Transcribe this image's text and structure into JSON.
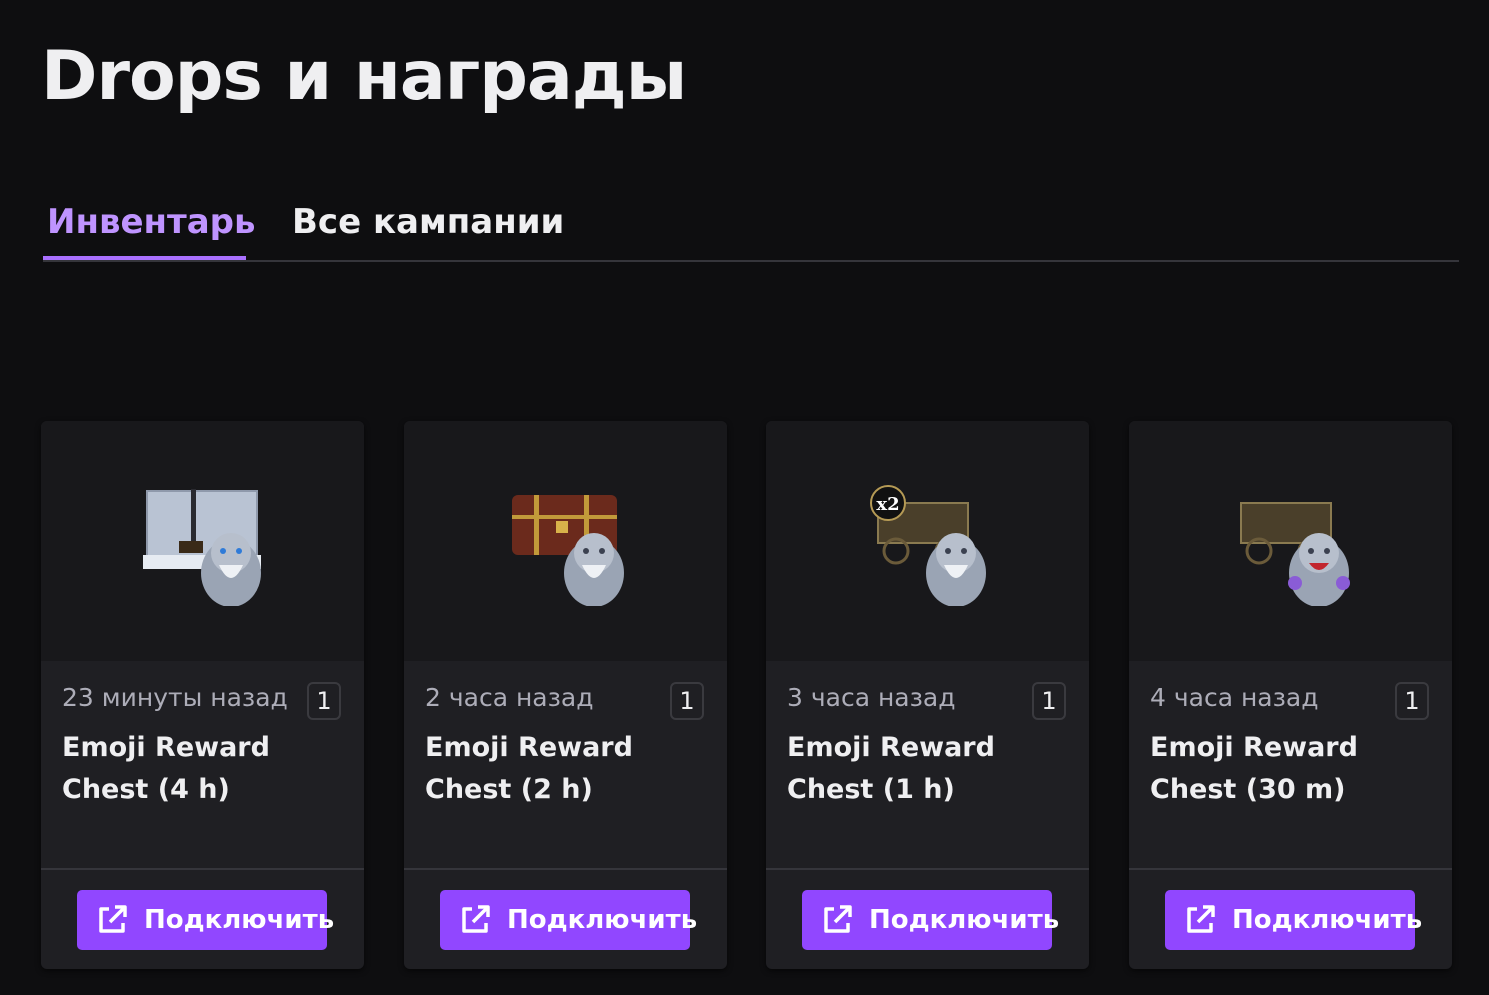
{
  "page": {
    "title": "Drops и награды"
  },
  "tabs": [
    {
      "label": "Инвентарь",
      "active": true
    },
    {
      "label": "Все кампании",
      "active": false
    }
  ],
  "cards": [
    {
      "time": "23 минуты назад",
      "quantity": "1",
      "name": "Emoji Reward Chest (4 h)",
      "button_label": "Подключить",
      "image_icon": "ice-chest-character-icon"
    },
    {
      "time": "2 часа назад",
      "quantity": "1",
      "name": "Emoji Reward Chest (2 h)",
      "button_label": "Подключить",
      "image_icon": "wooden-chest-character-icon"
    },
    {
      "time": "3 часа назад",
      "quantity": "1",
      "name": "Emoji Reward Chest (1 h)",
      "button_label": "Подключить",
      "image_icon": "cart-x2-character-icon",
      "image_badge": "x2"
    },
    {
      "time": "4 часа назад",
      "quantity": "1",
      "name": "Emoji Reward Chest (30 m)",
      "button_label": "Подключить",
      "image_icon": "cart-character-icon"
    }
  ],
  "colors": {
    "background": "#0e0e10",
    "card": "#1f1f23",
    "accent": "#9147ff",
    "active_tab": "#bf94ff"
  }
}
